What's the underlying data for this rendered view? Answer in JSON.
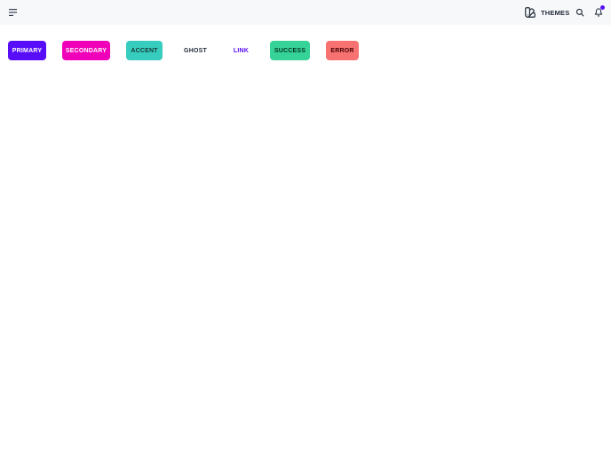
{
  "header": {
    "themes_label": "THEMES",
    "icons": {
      "menu": "menu-lines-icon",
      "themes": "swatch-book-icon",
      "search": "search-icon",
      "notifications": "bell-icon"
    },
    "has_notification": true
  },
  "buttons": {
    "primary": {
      "label": "PRIMARY",
      "bg": "#570df8",
      "fg": "#ffffff"
    },
    "secondary": {
      "label": "SECONDARY",
      "bg": "#f000b8",
      "fg": "#ffffff"
    },
    "accent": {
      "label": "ACCENT",
      "bg": "#37cdbe",
      "fg": "#163835"
    },
    "ghost": {
      "label": "GHOST"
    },
    "link": {
      "label": "LINK",
      "fg": "#570df8"
    },
    "success": {
      "label": "SUCCESS",
      "bg": "#36d399",
      "fg": "#003320"
    },
    "error": {
      "label": "ERROR",
      "bg": "#f87272",
      "fg": "#470000"
    }
  }
}
